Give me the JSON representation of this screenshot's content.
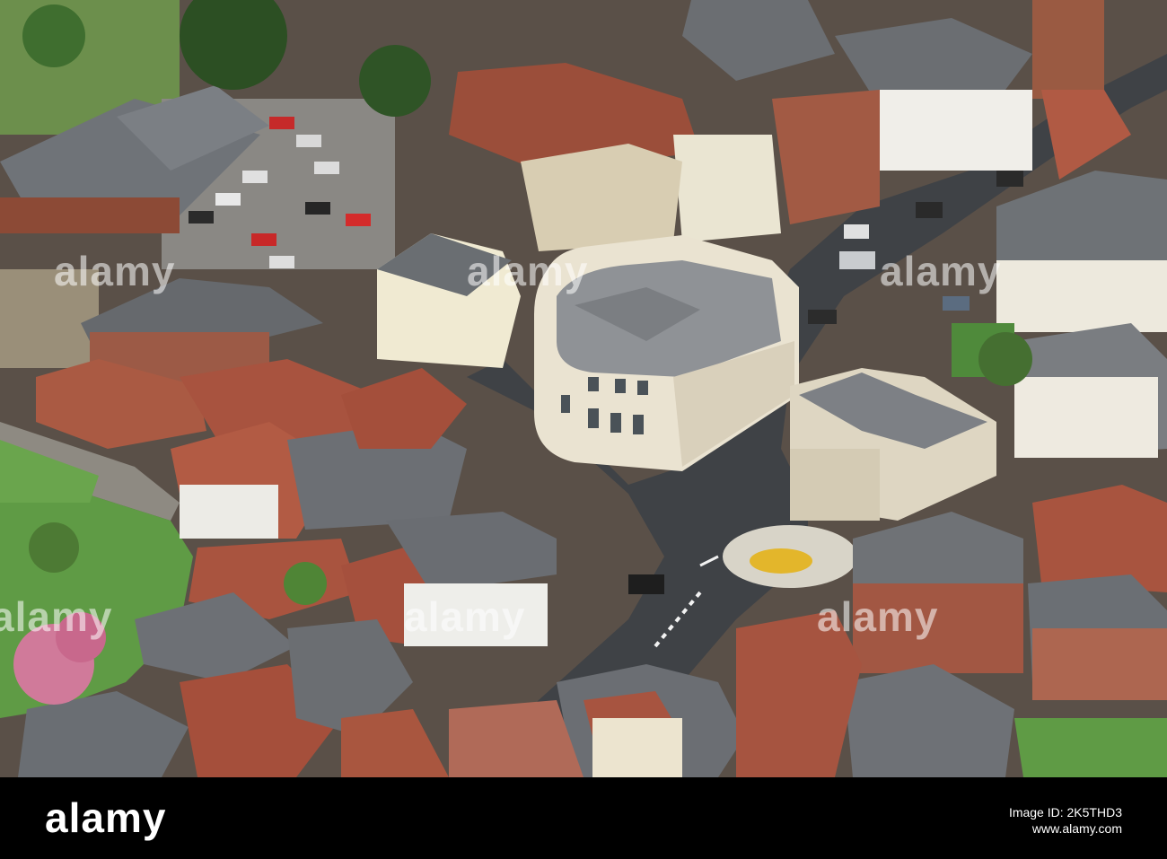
{
  "watermark": {
    "brand": "alamy"
  },
  "bottom_bar": {
    "logo": "alamy",
    "image_id_label": "Image ID: 2K5THD3",
    "url": "www.alamy.com"
  },
  "colors": {
    "bar_background": "#000000",
    "roof_slate": "#6f7378",
    "roof_tile": "#a5543f",
    "lawn": "#5f9b45",
    "road": "#3f4246",
    "stone": "#e6dfcf"
  }
}
